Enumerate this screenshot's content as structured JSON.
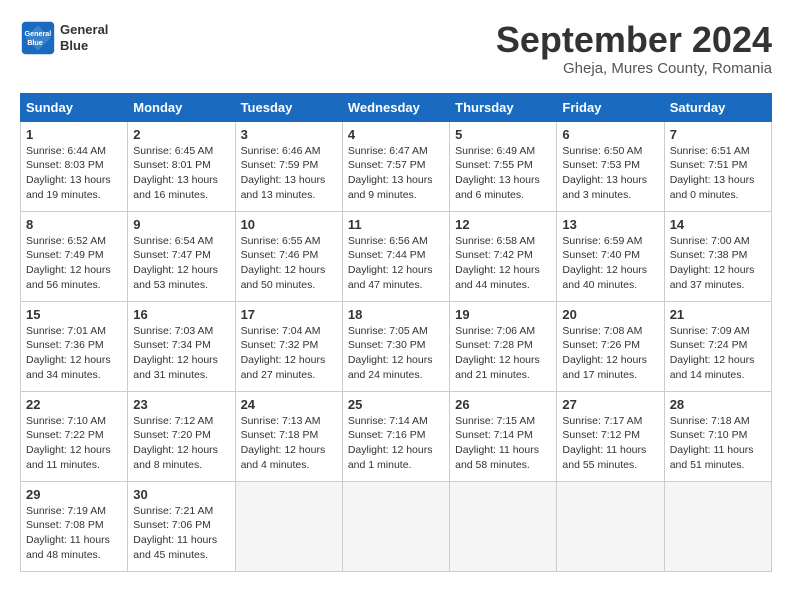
{
  "header": {
    "logo_line1": "General",
    "logo_line2": "Blue",
    "month_title": "September 2024",
    "subtitle": "Gheja, Mures County, Romania"
  },
  "weekdays": [
    "Sunday",
    "Monday",
    "Tuesday",
    "Wednesday",
    "Thursday",
    "Friday",
    "Saturday"
  ],
  "weeks": [
    [
      {
        "day": "1",
        "info": "Sunrise: 6:44 AM\nSunset: 8:03 PM\nDaylight: 13 hours\nand 19 minutes."
      },
      {
        "day": "2",
        "info": "Sunrise: 6:45 AM\nSunset: 8:01 PM\nDaylight: 13 hours\nand 16 minutes."
      },
      {
        "day": "3",
        "info": "Sunrise: 6:46 AM\nSunset: 7:59 PM\nDaylight: 13 hours\nand 13 minutes."
      },
      {
        "day": "4",
        "info": "Sunrise: 6:47 AM\nSunset: 7:57 PM\nDaylight: 13 hours\nand 9 minutes."
      },
      {
        "day": "5",
        "info": "Sunrise: 6:49 AM\nSunset: 7:55 PM\nDaylight: 13 hours\nand 6 minutes."
      },
      {
        "day": "6",
        "info": "Sunrise: 6:50 AM\nSunset: 7:53 PM\nDaylight: 13 hours\nand 3 minutes."
      },
      {
        "day": "7",
        "info": "Sunrise: 6:51 AM\nSunset: 7:51 PM\nDaylight: 13 hours\nand 0 minutes."
      }
    ],
    [
      {
        "day": "8",
        "info": "Sunrise: 6:52 AM\nSunset: 7:49 PM\nDaylight: 12 hours\nand 56 minutes."
      },
      {
        "day": "9",
        "info": "Sunrise: 6:54 AM\nSunset: 7:47 PM\nDaylight: 12 hours\nand 53 minutes."
      },
      {
        "day": "10",
        "info": "Sunrise: 6:55 AM\nSunset: 7:46 PM\nDaylight: 12 hours\nand 50 minutes."
      },
      {
        "day": "11",
        "info": "Sunrise: 6:56 AM\nSunset: 7:44 PM\nDaylight: 12 hours\nand 47 minutes."
      },
      {
        "day": "12",
        "info": "Sunrise: 6:58 AM\nSunset: 7:42 PM\nDaylight: 12 hours\nand 44 minutes."
      },
      {
        "day": "13",
        "info": "Sunrise: 6:59 AM\nSunset: 7:40 PM\nDaylight: 12 hours\nand 40 minutes."
      },
      {
        "day": "14",
        "info": "Sunrise: 7:00 AM\nSunset: 7:38 PM\nDaylight: 12 hours\nand 37 minutes."
      }
    ],
    [
      {
        "day": "15",
        "info": "Sunrise: 7:01 AM\nSunset: 7:36 PM\nDaylight: 12 hours\nand 34 minutes."
      },
      {
        "day": "16",
        "info": "Sunrise: 7:03 AM\nSunset: 7:34 PM\nDaylight: 12 hours\nand 31 minutes."
      },
      {
        "day": "17",
        "info": "Sunrise: 7:04 AM\nSunset: 7:32 PM\nDaylight: 12 hours\nand 27 minutes."
      },
      {
        "day": "18",
        "info": "Sunrise: 7:05 AM\nSunset: 7:30 PM\nDaylight: 12 hours\nand 24 minutes."
      },
      {
        "day": "19",
        "info": "Sunrise: 7:06 AM\nSunset: 7:28 PM\nDaylight: 12 hours\nand 21 minutes."
      },
      {
        "day": "20",
        "info": "Sunrise: 7:08 AM\nSunset: 7:26 PM\nDaylight: 12 hours\nand 17 minutes."
      },
      {
        "day": "21",
        "info": "Sunrise: 7:09 AM\nSunset: 7:24 PM\nDaylight: 12 hours\nand 14 minutes."
      }
    ],
    [
      {
        "day": "22",
        "info": "Sunrise: 7:10 AM\nSunset: 7:22 PM\nDaylight: 12 hours\nand 11 minutes."
      },
      {
        "day": "23",
        "info": "Sunrise: 7:12 AM\nSunset: 7:20 PM\nDaylight: 12 hours\nand 8 minutes."
      },
      {
        "day": "24",
        "info": "Sunrise: 7:13 AM\nSunset: 7:18 PM\nDaylight: 12 hours\nand 4 minutes."
      },
      {
        "day": "25",
        "info": "Sunrise: 7:14 AM\nSunset: 7:16 PM\nDaylight: 12 hours\nand 1 minute."
      },
      {
        "day": "26",
        "info": "Sunrise: 7:15 AM\nSunset: 7:14 PM\nDaylight: 11 hours\nand 58 minutes."
      },
      {
        "day": "27",
        "info": "Sunrise: 7:17 AM\nSunset: 7:12 PM\nDaylight: 11 hours\nand 55 minutes."
      },
      {
        "day": "28",
        "info": "Sunrise: 7:18 AM\nSunset: 7:10 PM\nDaylight: 11 hours\nand 51 minutes."
      }
    ],
    [
      {
        "day": "29",
        "info": "Sunrise: 7:19 AM\nSunset: 7:08 PM\nDaylight: 11 hours\nand 48 minutes."
      },
      {
        "day": "30",
        "info": "Sunrise: 7:21 AM\nSunset: 7:06 PM\nDaylight: 11 hours\nand 45 minutes."
      },
      {
        "day": "",
        "info": ""
      },
      {
        "day": "",
        "info": ""
      },
      {
        "day": "",
        "info": ""
      },
      {
        "day": "",
        "info": ""
      },
      {
        "day": "",
        "info": ""
      }
    ]
  ]
}
